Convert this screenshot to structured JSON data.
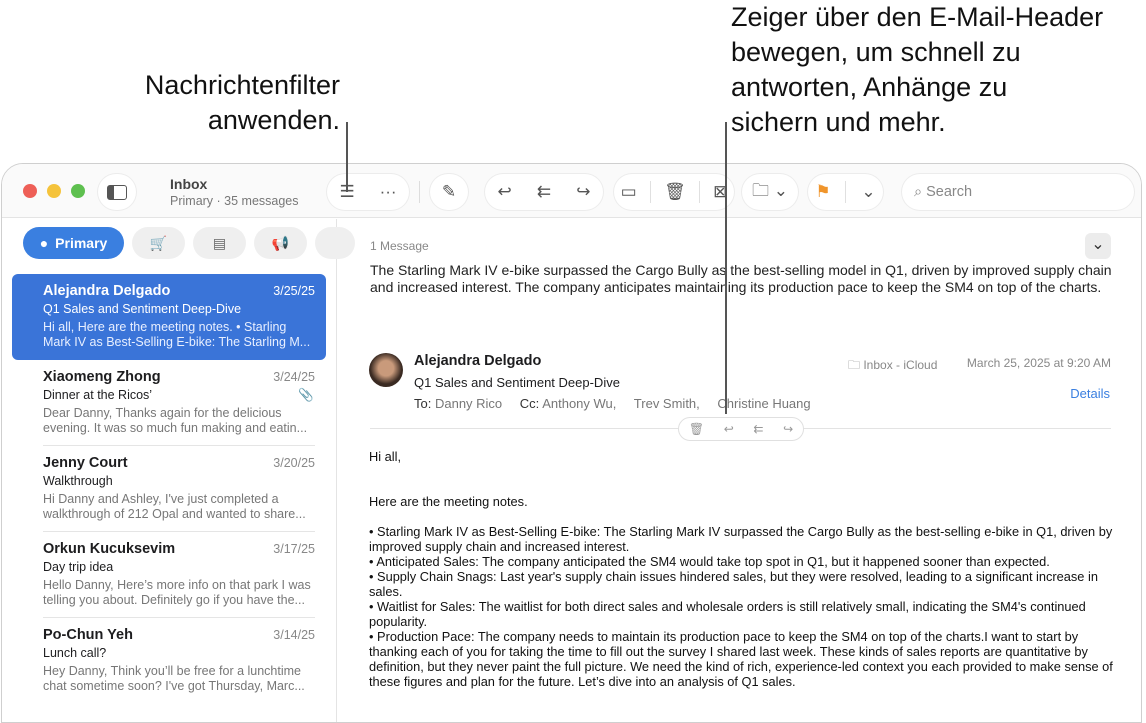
{
  "callouts": {
    "filter_line1": "Nachrichtenfilter",
    "filter_line2": "anwenden.",
    "header_line1": "Zeiger über den E-Mail-Header",
    "header_line2": "bewegen, um schnell zu",
    "header_line3": "antworten, Anhänge zu",
    "header_line4": "sichern und mehr."
  },
  "toolbar": {
    "title": "Inbox",
    "subtitle": "Primary · 35 messages",
    "search_placeholder": "Search",
    "flag_color": "#f0952b"
  },
  "categories": {
    "primary": "Primary"
  },
  "messages": [
    {
      "from": "Alejandra Delgado",
      "date": "3/25/25",
      "subject": "Q1 Sales and Sentiment Deep-Dive",
      "preview": "Hi all, Here are the meeting notes. • Starling Mark IV as Best-Selling E-bike: The Starling M..."
    },
    {
      "from": "Xiaomeng Zhong",
      "date": "3/24/25",
      "subject": "Dinner at the Ricos’",
      "preview": "Dear Danny, Thanks again for the delicious evening. It was so much fun making and eatin..."
    },
    {
      "from": "Jenny Court",
      "date": "3/20/25",
      "subject": "Walkthrough",
      "preview": "Hi Danny and Ashley, I've just completed a walkthrough of 212 Opal and wanted to share..."
    },
    {
      "from": "Orkun Kucuksevim",
      "date": "3/17/25",
      "subject": "Day trip idea",
      "preview": "Hello Danny, Here’s more info on that park I was telling you about. Definitely go if you have the..."
    },
    {
      "from": "Po-Chun Yeh",
      "date": "3/14/25",
      "subject": "Lunch call?",
      "preview": "Hey Danny, Think you’ll be free for a lunchtime chat sometime soon? I've got Thursday, Marc..."
    }
  ],
  "thread": {
    "count": "1 Message",
    "summary": "The Starling Mark IV e-bike surpassed the Cargo Bully as the best-selling model in Q1, driven by improved supply chain and increased interest. The company anticipates maintaining its production pace to keep the SM4 on top of the charts."
  },
  "email": {
    "from": "Alejandra Delgado",
    "subject": "Q1 Sales and Sentiment Deep-Dive",
    "to_label": "To:",
    "to": "Danny Rico",
    "cc_label": "Cc:",
    "cc1": "Anthony Wu,",
    "cc2": "Trev Smith,",
    "cc3": "Christine Huang",
    "mailbox": "Inbox - iCloud",
    "date": "March 25, 2025 at 9:20 AM",
    "details": "Details",
    "body": [
      "Hi all,",
      "Here are the meeting notes.",
      "• Starling Mark IV as Best-Selling E-bike: The Starling Mark IV surpassed the Cargo Bully as the best-selling e-bike in Q1, driven by improved supply chain and increased interest.",
      "• Anticipated Sales: The company anticipated the SM4 would take top spot in Q1, but it happened sooner than expected.",
      "• Supply Chain Snags: Last year's supply chain issues hindered sales, but they were resolved, leading to a significant increase in sales.",
      "• Waitlist for Sales: The waitlist for both direct sales and wholesale orders is still relatively small, indicating the SM4's continued popularity.",
      "• Production Pace: The company needs to maintain its production pace to keep the SM4 on top of the charts.I want to start by thanking each of you for taking the time to fill out the survey I shared last week. These kinds of sales reports are quantitative by definition, but they never paint the full picture. We need the kind of rich, experience-led context you each provided to make sense of these figures and plan for the future. Let’s dive into an analysis of Q1 sales."
    ]
  }
}
